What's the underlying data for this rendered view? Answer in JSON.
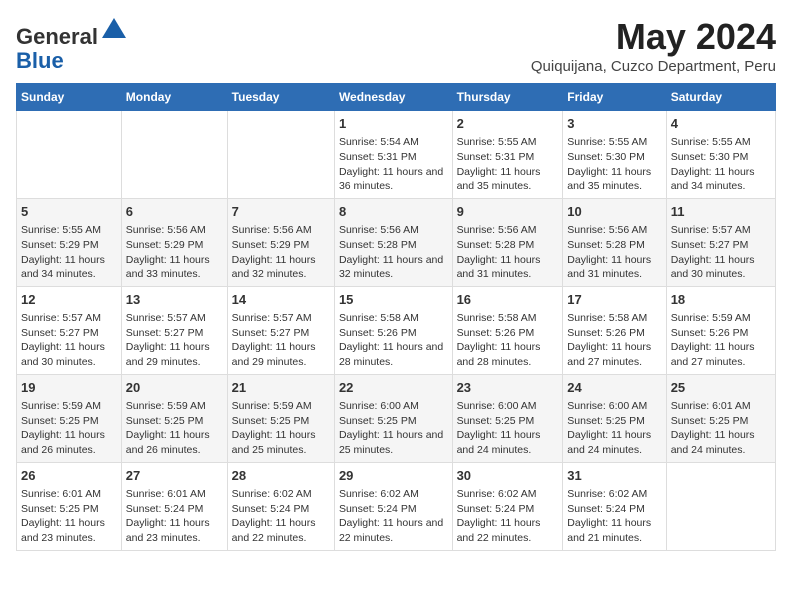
{
  "logo": {
    "general": "General",
    "blue": "Blue"
  },
  "title": "May 2024",
  "subtitle": "Quiquijana, Cuzco Department, Peru",
  "days_of_week": [
    "Sunday",
    "Monday",
    "Tuesday",
    "Wednesday",
    "Thursday",
    "Friday",
    "Saturday"
  ],
  "weeks": [
    [
      {
        "day": "",
        "info": ""
      },
      {
        "day": "",
        "info": ""
      },
      {
        "day": "",
        "info": ""
      },
      {
        "day": "1",
        "info": "Sunrise: 5:54 AM\nSunset: 5:31 PM\nDaylight: 11 hours and 36 minutes."
      },
      {
        "day": "2",
        "info": "Sunrise: 5:55 AM\nSunset: 5:31 PM\nDaylight: 11 hours and 35 minutes."
      },
      {
        "day": "3",
        "info": "Sunrise: 5:55 AM\nSunset: 5:30 PM\nDaylight: 11 hours and 35 minutes."
      },
      {
        "day": "4",
        "info": "Sunrise: 5:55 AM\nSunset: 5:30 PM\nDaylight: 11 hours and 34 minutes."
      }
    ],
    [
      {
        "day": "5",
        "info": "Sunrise: 5:55 AM\nSunset: 5:29 PM\nDaylight: 11 hours and 34 minutes."
      },
      {
        "day": "6",
        "info": "Sunrise: 5:56 AM\nSunset: 5:29 PM\nDaylight: 11 hours and 33 minutes."
      },
      {
        "day": "7",
        "info": "Sunrise: 5:56 AM\nSunset: 5:29 PM\nDaylight: 11 hours and 32 minutes."
      },
      {
        "day": "8",
        "info": "Sunrise: 5:56 AM\nSunset: 5:28 PM\nDaylight: 11 hours and 32 minutes."
      },
      {
        "day": "9",
        "info": "Sunrise: 5:56 AM\nSunset: 5:28 PM\nDaylight: 11 hours and 31 minutes."
      },
      {
        "day": "10",
        "info": "Sunrise: 5:56 AM\nSunset: 5:28 PM\nDaylight: 11 hours and 31 minutes."
      },
      {
        "day": "11",
        "info": "Sunrise: 5:57 AM\nSunset: 5:27 PM\nDaylight: 11 hours and 30 minutes."
      }
    ],
    [
      {
        "day": "12",
        "info": "Sunrise: 5:57 AM\nSunset: 5:27 PM\nDaylight: 11 hours and 30 minutes."
      },
      {
        "day": "13",
        "info": "Sunrise: 5:57 AM\nSunset: 5:27 PM\nDaylight: 11 hours and 29 minutes."
      },
      {
        "day": "14",
        "info": "Sunrise: 5:57 AM\nSunset: 5:27 PM\nDaylight: 11 hours and 29 minutes."
      },
      {
        "day": "15",
        "info": "Sunrise: 5:58 AM\nSunset: 5:26 PM\nDaylight: 11 hours and 28 minutes."
      },
      {
        "day": "16",
        "info": "Sunrise: 5:58 AM\nSunset: 5:26 PM\nDaylight: 11 hours and 28 minutes."
      },
      {
        "day": "17",
        "info": "Sunrise: 5:58 AM\nSunset: 5:26 PM\nDaylight: 11 hours and 27 minutes."
      },
      {
        "day": "18",
        "info": "Sunrise: 5:59 AM\nSunset: 5:26 PM\nDaylight: 11 hours and 27 minutes."
      }
    ],
    [
      {
        "day": "19",
        "info": "Sunrise: 5:59 AM\nSunset: 5:25 PM\nDaylight: 11 hours and 26 minutes."
      },
      {
        "day": "20",
        "info": "Sunrise: 5:59 AM\nSunset: 5:25 PM\nDaylight: 11 hours and 26 minutes."
      },
      {
        "day": "21",
        "info": "Sunrise: 5:59 AM\nSunset: 5:25 PM\nDaylight: 11 hours and 25 minutes."
      },
      {
        "day": "22",
        "info": "Sunrise: 6:00 AM\nSunset: 5:25 PM\nDaylight: 11 hours and 25 minutes."
      },
      {
        "day": "23",
        "info": "Sunrise: 6:00 AM\nSunset: 5:25 PM\nDaylight: 11 hours and 24 minutes."
      },
      {
        "day": "24",
        "info": "Sunrise: 6:00 AM\nSunset: 5:25 PM\nDaylight: 11 hours and 24 minutes."
      },
      {
        "day": "25",
        "info": "Sunrise: 6:01 AM\nSunset: 5:25 PM\nDaylight: 11 hours and 24 minutes."
      }
    ],
    [
      {
        "day": "26",
        "info": "Sunrise: 6:01 AM\nSunset: 5:25 PM\nDaylight: 11 hours and 23 minutes."
      },
      {
        "day": "27",
        "info": "Sunrise: 6:01 AM\nSunset: 5:24 PM\nDaylight: 11 hours and 23 minutes."
      },
      {
        "day": "28",
        "info": "Sunrise: 6:02 AM\nSunset: 5:24 PM\nDaylight: 11 hours and 22 minutes."
      },
      {
        "day": "29",
        "info": "Sunrise: 6:02 AM\nSunset: 5:24 PM\nDaylight: 11 hours and 22 minutes."
      },
      {
        "day": "30",
        "info": "Sunrise: 6:02 AM\nSunset: 5:24 PM\nDaylight: 11 hours and 22 minutes."
      },
      {
        "day": "31",
        "info": "Sunrise: 6:02 AM\nSunset: 5:24 PM\nDaylight: 11 hours and 21 minutes."
      },
      {
        "day": "",
        "info": ""
      }
    ]
  ]
}
